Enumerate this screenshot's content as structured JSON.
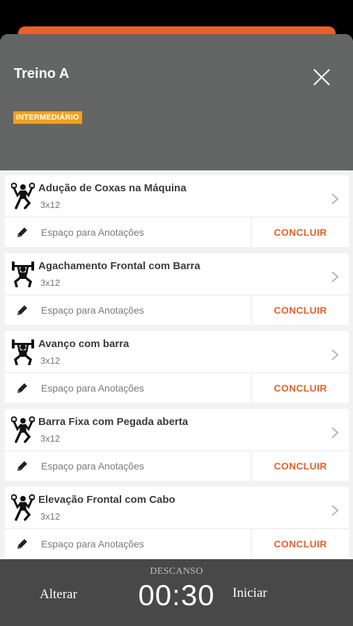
{
  "workout": {
    "title": "Treino A",
    "level": "INTERMEDIÁRIO"
  },
  "exercises": [
    {
      "name": "Adução de Coxas na Máquina",
      "sets": "3x12",
      "icon": "dumbbell-lift-icon",
      "notes_placeholder": "Espaço para Anotações",
      "action": "CONCLUIR"
    },
    {
      "name": "Agachamento Frontal com Barra",
      "sets": "3x12",
      "icon": "barbell-squat-icon",
      "notes_placeholder": "Espaço para Anotações",
      "action": "CONCLUIR"
    },
    {
      "name": "Avanço com barra",
      "sets": "3x12",
      "icon": "barbell-squat-icon",
      "notes_placeholder": "Espaço para Anotações",
      "action": "CONCLUIR"
    },
    {
      "name": "Barra Fixa com Pegada aberta",
      "sets": "3x12",
      "icon": "dumbbell-lift-icon",
      "notes_placeholder": "Espaço para Anotações",
      "action": "CONCLUIR"
    },
    {
      "name": "Elevação Frontal com Cabo",
      "sets": "3x12",
      "icon": "dumbbell-lift-icon",
      "notes_placeholder": "Espaço para Anotações",
      "action": "CONCLUIR"
    }
  ],
  "rest": {
    "label": "DESCANSO",
    "time": "00:30",
    "change_label": "Alterar",
    "start_label": "Iniciar"
  },
  "colors": {
    "accent": "#e8612c",
    "badge": "#f5a01a",
    "header": "#646565",
    "footer": "#484848"
  }
}
